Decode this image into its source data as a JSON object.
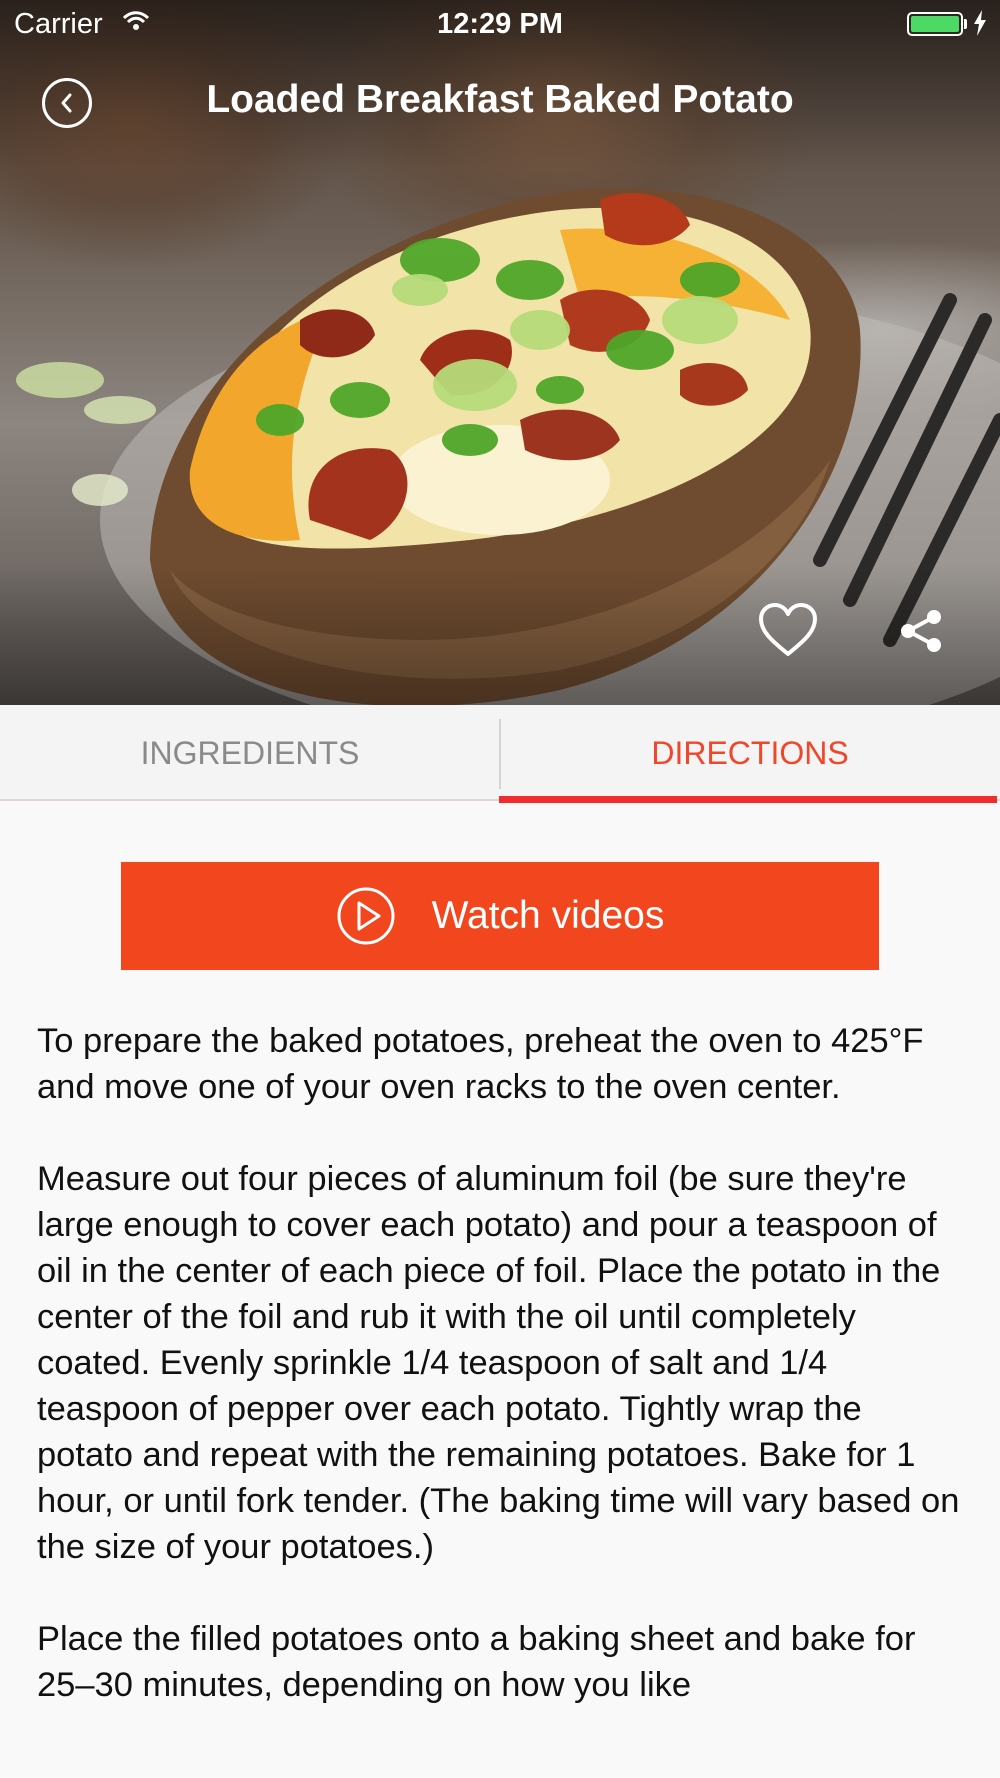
{
  "status_bar": {
    "carrier": "Carrier",
    "time": "12:29 PM",
    "battery_color": "#4cd964"
  },
  "header": {
    "title": "Loaded Breakfast Baked Potato",
    "back_icon": "chevron-left-circle-icon",
    "favorite_icon": "heart-outline-icon",
    "share_icon": "share-icon"
  },
  "tabs": [
    {
      "label": "INGREDIENTS",
      "selected": false
    },
    {
      "label": "DIRECTIONS",
      "selected": true
    }
  ],
  "watch_button": {
    "label": "Watch videos",
    "icon": "play-circle-icon",
    "color": "#f2461f"
  },
  "colors": {
    "accent": "#f0472a",
    "tab_underline": "#f22c2c"
  },
  "directions": [
    "To prepare the baked potatoes, preheat the oven to 425°F and move one of your oven racks to the oven center.",
    "Measure out four pieces of aluminum foil (be sure they're large enough to cover each potato) and pour a teaspoon of oil in the center of each piece of foil. Place the potato in the center of the foil and rub it with the oil until completely coated. Evenly sprinkle 1/4 teaspoon of salt and 1/4 teaspoon of pepper over each potato. Tightly wrap the potato and repeat with the remaining potatoes. Bake for 1 hour, or until fork tender. (The baking time will vary based on the size of your potatoes.)",
    "Place the filled potatoes onto a baking sheet and bake for 25–30 minutes, depending on how you like"
  ]
}
